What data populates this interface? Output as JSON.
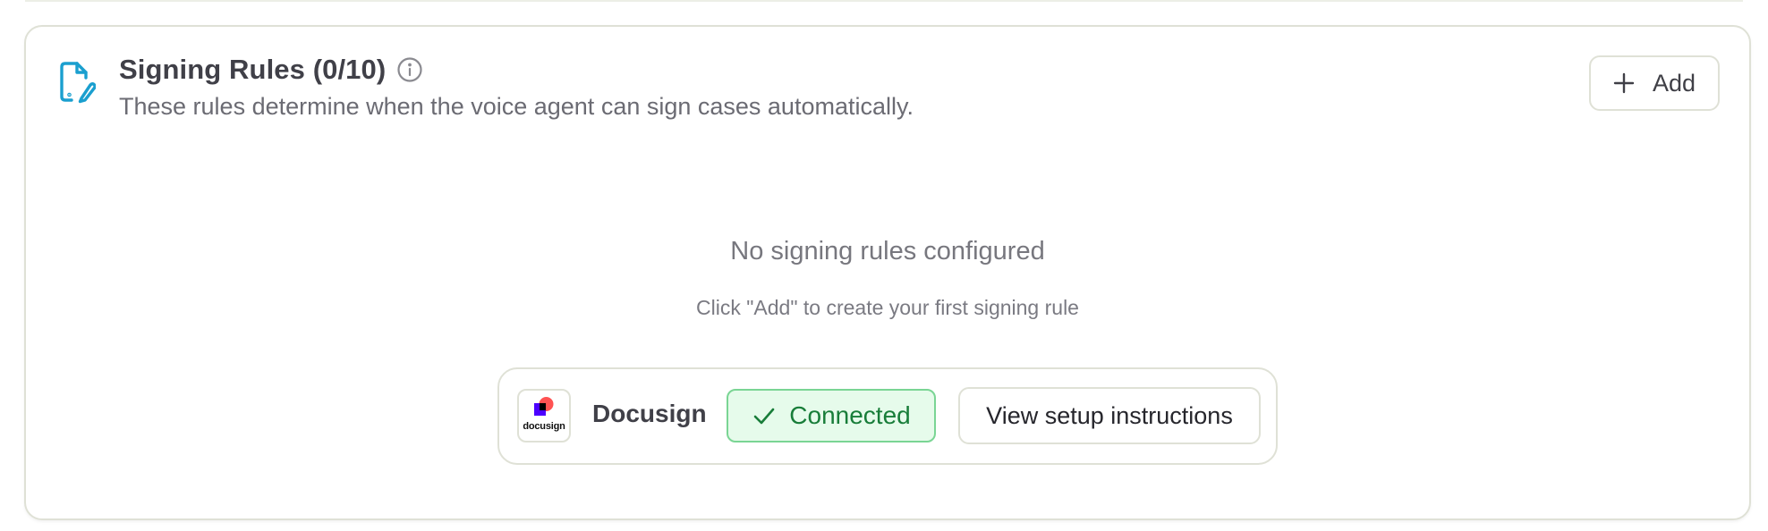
{
  "section": {
    "title": "Signing Rules (0/10)",
    "subtitle": "These rules determine when the voice agent can sign cases automatically.",
    "header_icon": "document-signature-icon",
    "info_icon": "info-icon"
  },
  "toolbar": {
    "add_label": "Add",
    "add_icon": "plus-icon"
  },
  "empty_state": {
    "title": "No signing rules configured",
    "hint": "Click \"Add\" to create your first signing rule"
  },
  "integration": {
    "logo_text": "docusign",
    "name": "Docusign",
    "status_label": "Connected",
    "status_icon": "check-icon",
    "setup_label": "View setup instructions"
  },
  "colors": {
    "accent": "#1a9fcf",
    "border": "#dfe1d6",
    "connected_bg": "#e6fbeb",
    "connected_border": "#7ad594",
    "connected_text": "#187d39",
    "docusign_purple": "#4c00ff",
    "docusign_red": "#ff5252"
  }
}
